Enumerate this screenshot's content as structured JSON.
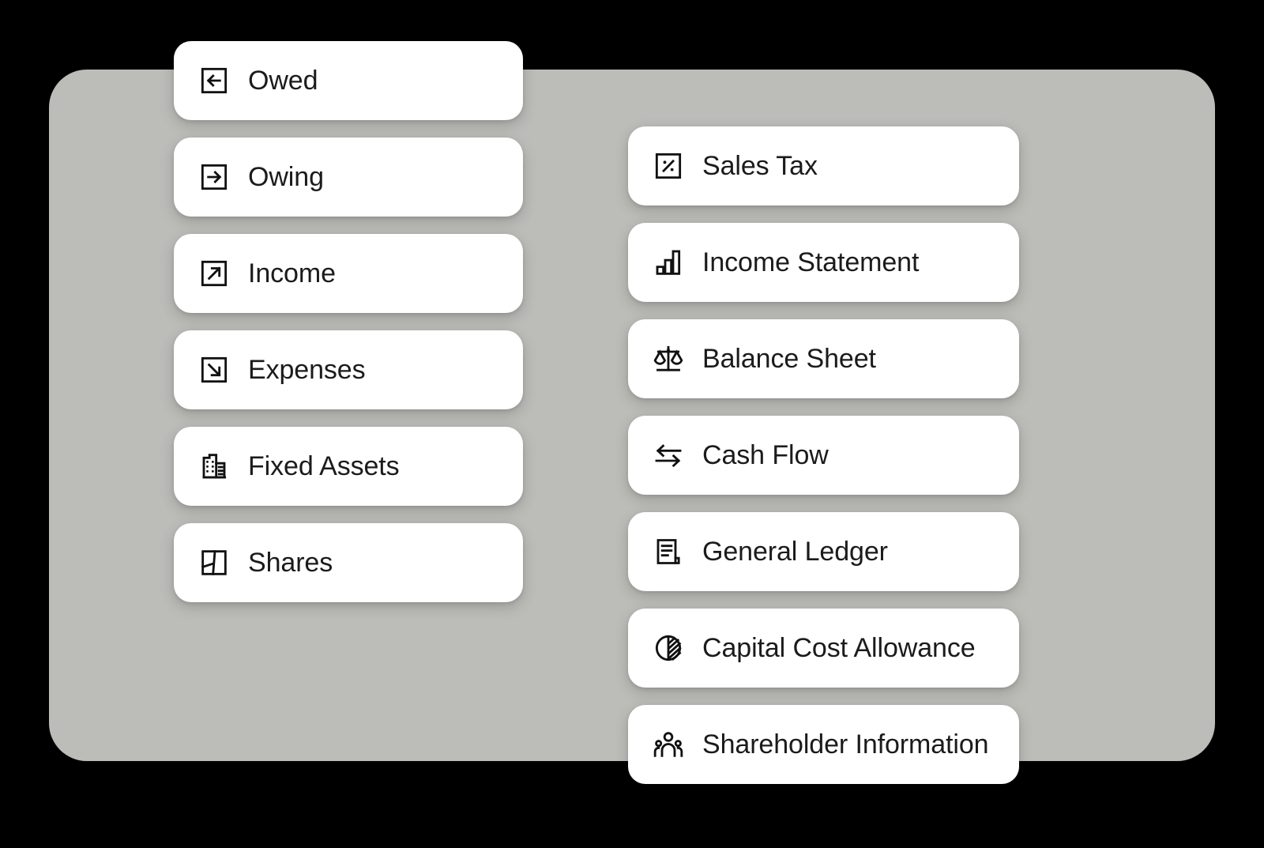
{
  "theme": {
    "background": "#000000",
    "panel_color": "#bcbcb8",
    "card_color": "#ffffff",
    "text_color": "#1b1b1b"
  },
  "panel": {
    "name": "accounting-menu-panel"
  },
  "columns": [
    {
      "name": "left-column",
      "items": [
        {
          "label": "Owed",
          "icon": "arrow-left-box-icon"
        },
        {
          "label": "Owing",
          "icon": "arrow-right-box-icon"
        },
        {
          "label": "Income",
          "icon": "arrow-up-right-box-icon"
        },
        {
          "label": "Expenses",
          "icon": "arrow-down-right-box-icon"
        },
        {
          "label": "Fixed Assets",
          "icon": "building-icon"
        },
        {
          "label": "Shares",
          "icon": "share-split-square-icon"
        }
      ]
    },
    {
      "name": "right-column",
      "items": [
        {
          "label": "Sales Tax",
          "icon": "percent-box-icon"
        },
        {
          "label": "Income Statement",
          "icon": "bar-chart-icon"
        },
        {
          "label": "Balance Sheet",
          "icon": "scales-icon"
        },
        {
          "label": "Cash Flow",
          "icon": "two-way-arrows-icon"
        },
        {
          "label": "General Ledger",
          "icon": "document-lines-icon"
        },
        {
          "label": "Capital Cost Allowance",
          "icon": "pie-chart-hatched-icon"
        },
        {
          "label": "Shareholder Information",
          "icon": "people-group-icon"
        }
      ]
    }
  ]
}
